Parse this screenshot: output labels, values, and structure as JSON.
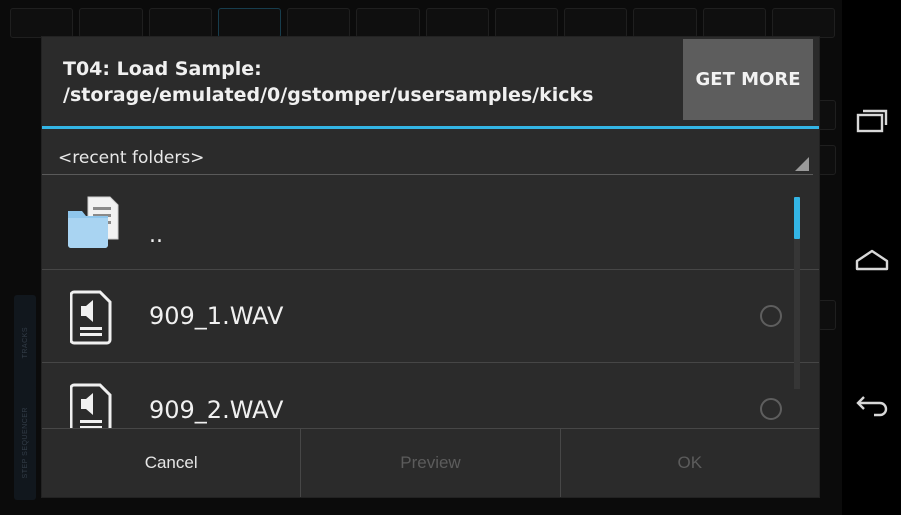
{
  "dialog": {
    "title_line1": "T04: Load Sample:",
    "title_line2": "/storage/emulated/0/gstomper/usersamples/kicks",
    "get_more_label": "GET MORE",
    "folder_selector": "<recent folders>",
    "files": [
      {
        "name": "..",
        "icon": "folder-icon",
        "selected": false
      },
      {
        "name": "909_1.WAV",
        "icon": "audio-file-icon",
        "selected": false
      },
      {
        "name": "909_2.WAV",
        "icon": "audio-file-icon",
        "selected": false
      }
    ],
    "buttons": {
      "cancel": "Cancel",
      "preview": "Preview",
      "ok": "OK"
    }
  },
  "background_app": {
    "side_tabs": [
      "TRACKS",
      "STEP SEQUENCER"
    ]
  },
  "navbar": {
    "icons": [
      "recent-apps-icon",
      "home-icon",
      "back-icon"
    ]
  },
  "colors": {
    "accent": "#33b5e5",
    "dialog_bg": "#2b2b2b",
    "get_more_bg": "#5d5d5d",
    "disabled_text": "#5c5c5c"
  }
}
